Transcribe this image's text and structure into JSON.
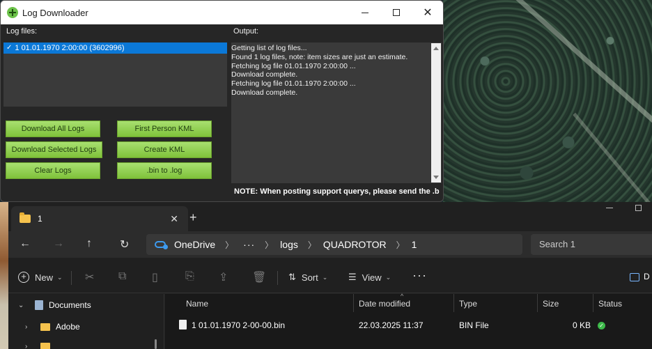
{
  "log_window": {
    "title": "Log Downloader",
    "logfiles_label": "Log files:",
    "output_label": "Output:",
    "log_item": "1 01.01.1970 2:00:00  (3602996)",
    "buttons": {
      "download_all": "Download All Logs",
      "download_selected": "Download Selected Logs",
      "clear_logs": "Clear Logs",
      "first_person_kml": "First Person KML",
      "create_kml": "Create KML",
      "bin_to_log": ".bin to .log"
    },
    "output_lines": [
      "Getting list of log files...",
      "Found 1 log files, note: item sizes are just an estimate.",
      "Fetching log file 01.01.1970 2:00:00 ...",
      "Download complete.",
      "Fetching log file 01.01.1970 2:00:00 ...",
      "Download complete."
    ],
    "note": "NOTE: When posting support querys, please send the .b"
  },
  "explorer": {
    "tab_title": "1",
    "tab_close": "✕",
    "new_tab": "+",
    "breadcrumbs": [
      "OneDrive",
      "logs",
      "QUADROTOR",
      "1"
    ],
    "breadcrumb_more": "···",
    "search_placeholder": "Search 1",
    "commands": {
      "new": "New",
      "sort": "Sort",
      "view": "View",
      "more": "···",
      "details_pane": "D"
    },
    "nav_tree": [
      "Documents",
      "Adobe"
    ],
    "columns": [
      "Name",
      "Date modified",
      "Type",
      "Size",
      "Status"
    ],
    "files": [
      {
        "name": "1 01.01.1970 2-00-00.bin",
        "date_modified": "22.03.2025 11:37",
        "type": "BIN File",
        "size": "0 KB",
        "status": "synced"
      }
    ]
  }
}
